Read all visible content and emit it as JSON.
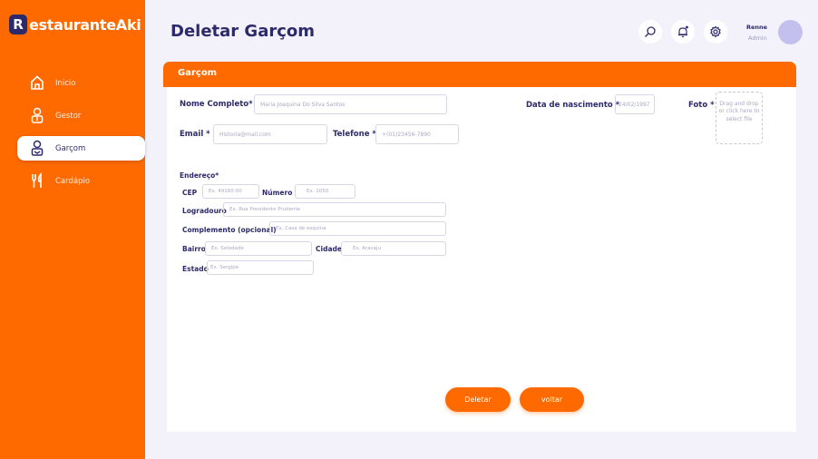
{
  "brand": {
    "initial": "R",
    "name": "estauranteAki"
  },
  "sidebar": {
    "items": [
      {
        "label": "Inicio"
      },
      {
        "label": "Gestor"
      },
      {
        "label": "Garçom"
      },
      {
        "label": "Cardápio"
      }
    ]
  },
  "header": {
    "title": "Deletar Garçom",
    "user_name": "Renne",
    "user_role": "Admin"
  },
  "card": {
    "title": "Garçom"
  },
  "form": {
    "nome_label": "Nome Completo*",
    "nome_value": "Maria Joaquina Do Silva Santos",
    "nascimento_label": "Data de nascimento *",
    "nascimento_value": "24/02/1997",
    "foto_label": "Foto *",
    "foto_drop": "Drag and drop or click here to select file",
    "email_label": "Email *",
    "email_value": "Historia@mail.com",
    "telefone_label": "Telefone *",
    "telefone_value": "+(01)23456-7890",
    "endereco_label": "Endereço*",
    "cep_label": "CEP",
    "cep_placeholder": "Ex. 49160-00",
    "numero_label": "Número",
    "numero_placeholder": "Ex. 1050",
    "logradouro_label": "Logradouro",
    "logradouro_placeholder": "Ex. Rua Presidente Prudente",
    "complemento_label": "Complemento (opcional)",
    "complemento_placeholder": "Ex. Casa de esquina",
    "bairro_label": "Bairro",
    "bairro_placeholder": "Ex. Soledade",
    "cidade_label": "Cidade",
    "cidade_placeholder": "Ex. Aracaju",
    "estado_label": "Estado",
    "estado_placeholder": "Ex. Sergipe"
  },
  "actions": {
    "delete_label": "Deletar",
    "back_label": "voltar"
  },
  "icons": {
    "nav": [
      "home-icon",
      "manager-icon",
      "waiter-icon",
      "cutlery-icon"
    ],
    "header": [
      "search-icon",
      "bell-icon",
      "gear-icon"
    ]
  },
  "colors": {
    "accent": "#ff6a00",
    "primary": "#2d2a6b",
    "background": "#f3f2fb"
  }
}
